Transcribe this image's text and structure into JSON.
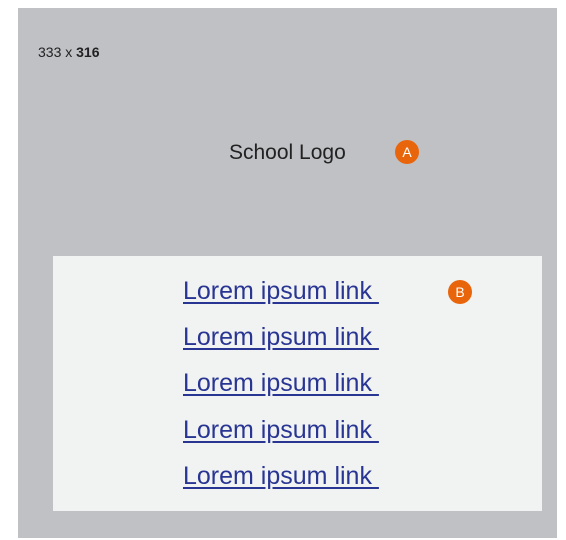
{
  "dimensions": {
    "width_text": "333 x ",
    "height_text": "316"
  },
  "logo": {
    "label": "School Logo",
    "badge": "A"
  },
  "links": {
    "badge": "B",
    "items": [
      "Lorem ipsum link ",
      "Lorem ipsum link ",
      "Lorem ipsum link ",
      "Lorem ipsum link ",
      "Lorem ipsum link "
    ]
  },
  "colors": {
    "panel_bg": "#c0c1c5",
    "links_bg": "#f1f2f2",
    "badge": "#e8650b",
    "link": "#283593"
  }
}
